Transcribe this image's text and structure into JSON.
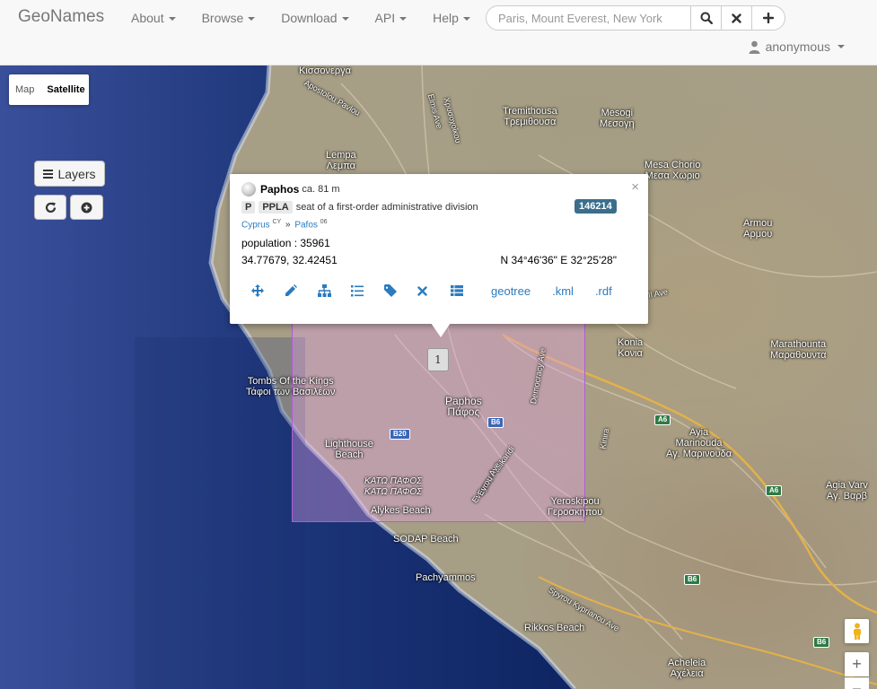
{
  "navbar": {
    "brand": "GeoNames",
    "menu": [
      {
        "label": "About"
      },
      {
        "label": "Browse"
      },
      {
        "label": "Download"
      },
      {
        "label": "API"
      },
      {
        "label": "Help"
      }
    ],
    "search": {
      "placeholder": "Paris, Mount Everest, New York",
      "value": ""
    },
    "user": "anonymous"
  },
  "map": {
    "map_type": {
      "map": "Map",
      "satellite": "Satellite",
      "selected": "Satellite"
    },
    "layers_label": "Layers",
    "cluster_count": "1",
    "boundary_color": "#b05cd8",
    "labels": [
      {
        "text": "Κισσονεργα"
      },
      {
        "text": "Tremithousa\nΤρεμιθουσα"
      },
      {
        "text": "Mesogi\nΜεσογη"
      },
      {
        "text": "Lempa\nΛεμπα"
      },
      {
        "text": "Mesa Chorio\nΜεσα Χωριο"
      },
      {
        "text": "Armou\nΑρμου"
      },
      {
        "text": "Konia\nΚονια"
      },
      {
        "text": "Marathounta\nΜαραθουντα"
      },
      {
        "text": "Tombs Of the Kings\nΤάφοι των Βασιλέων"
      },
      {
        "text": "Paphos\nΠάφος"
      },
      {
        "text": "Lighthouse\nBeach"
      },
      {
        "text": "ΚΑΤΩ ΠΑΦΟΣ\nΚΑΤΩ ΠΑΦΟΣ"
      },
      {
        "text": "Alykes Beach"
      },
      {
        "text": "Yeroskipou\nΓεροσκηπου"
      },
      {
        "text": "Ayia\nMarinouda\nΑγ. Μαρινουδα"
      },
      {
        "text": "Agia Varv\nΑγ. Βαρβ"
      },
      {
        "text": "SODAP Beach"
      },
      {
        "text": "Pachyammos"
      },
      {
        "text": "Rikkos Beach"
      },
      {
        "text": "Acheleia\nΑχέλεια"
      },
      {
        "text": "Evagora Pallikaridi"
      },
      {
        "text": "Democracy Ave"
      },
      {
        "text": "Evrou Ave"
      },
      {
        "text": "Elmis Ave"
      },
      {
        "text": "Kinira"
      },
      {
        "text": "Spyrou Kyprianou Ave"
      },
      {
        "text": "Apostolou Pavlou"
      },
      {
        "text": "Il Ave"
      },
      {
        "text": "Χρυσοχοΐκου"
      }
    ],
    "roads": [
      {
        "text": "B6"
      },
      {
        "text": "B20"
      },
      {
        "text": "A6"
      },
      {
        "text": "A6"
      },
      {
        "text": "B6"
      },
      {
        "text": "B6"
      }
    ],
    "zoom_in": "+",
    "zoom_out": "−"
  },
  "popup": {
    "name": "Paphos",
    "elevation": "ca. 81 m",
    "feature_class": "P",
    "feature_code": "PPLA",
    "feature_desc": "seat of a first-order administrative division",
    "geonameid": "146214",
    "country": "Cyprus",
    "country_code": "CY",
    "admin1": "Pafos",
    "admin1_code": "06",
    "population_label": "population : 35961",
    "coords": "34.77679, 32.42451",
    "dms": "N 34°46'36\" E 32°25'28\"",
    "actions": [
      "move",
      "edit",
      "hierarchy",
      "list",
      "tag",
      "delete",
      "table"
    ],
    "links": [
      "geotree",
      ".kml",
      ".rdf"
    ],
    "close": "×"
  }
}
